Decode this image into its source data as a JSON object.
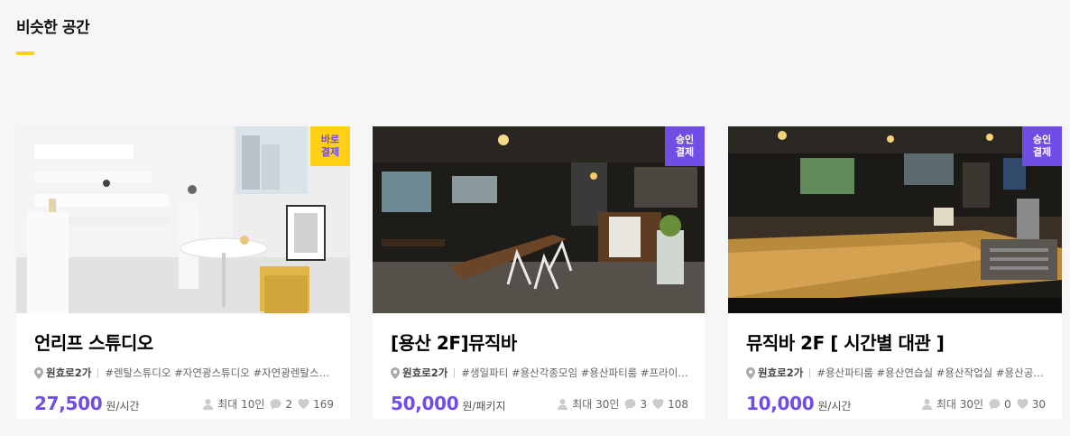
{
  "section": {
    "title": "비슷한 공간"
  },
  "colors": {
    "accent": "#704de4",
    "underline": "#ffd014",
    "badge_instant": "#ffd014",
    "badge_approval": "#704de4"
  },
  "cards": [
    {
      "badge": "바로\n결제",
      "badge_type": "instant",
      "name": "언리프 스튜디오",
      "location": "원효로2가",
      "tags": "#렌탈스튜디오 #자연광스튜디오 #자연광렌탈스튜디오",
      "price": "27,500",
      "unit": "원/시간",
      "capacity": "최대 10인",
      "comments": "2",
      "likes": "169"
    },
    {
      "badge": "승인\n결제",
      "badge_type": "approval",
      "name": "[용산 2F]뮤직바",
      "location": "원효로2가",
      "tags": "#생일파티 #용산각종모임 #용산파티룸 #프라이빗파티",
      "price": "50,000",
      "unit": "원/패키지",
      "capacity": "최대 30인",
      "comments": "3",
      "likes": "108"
    },
    {
      "badge": "승인\n결제",
      "badge_type": "approval",
      "name": "뮤직바 2F [ 시간별 대관 ]",
      "location": "원효로2가",
      "tags": "#용산파티룸 #용산연습실 #용산작업실 #용산공연장",
      "price": "10,000",
      "unit": "원/시간",
      "capacity": "최대 30인",
      "comments": "0",
      "likes": "30"
    }
  ]
}
